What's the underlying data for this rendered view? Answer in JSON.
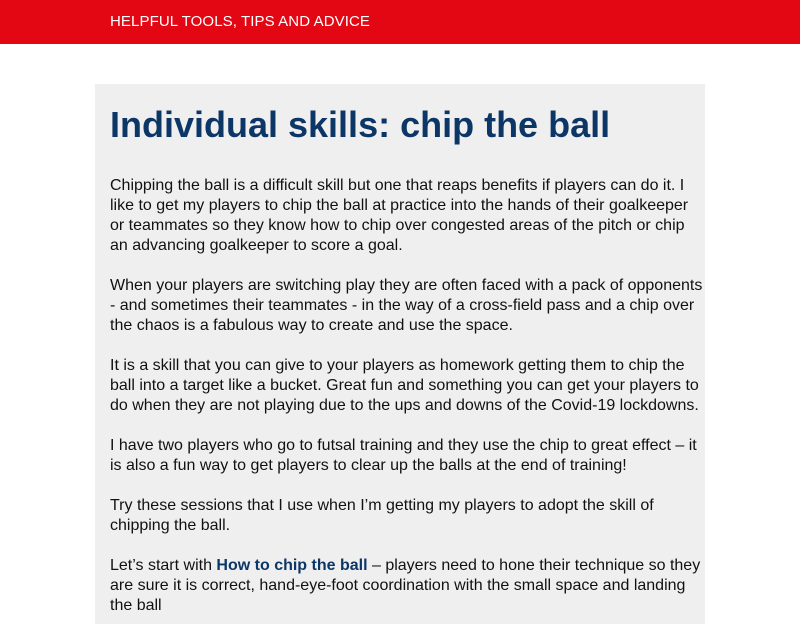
{
  "header": {
    "nav_link": "HELPFUL TOOLS, TIPS AND ADVICE"
  },
  "article": {
    "title": "Individual skills: chip the ball",
    "paragraphs": [
      "Chipping the ball is a difficult skill but one that reaps benefits if players can do it. I like to get my players to chip the ball at practice into the hands of their goalkeeper or teammates so they know how to chip over congested areas of the pitch or chip an advancing goalkeeper to score a goal.",
      "When your players are switching play they are often faced with a pack of opponents - and sometimes their teammates - in the way of a cross-field pass and a chip over the chaos is a fabulous way to create and use the space.",
      "It is a skill that you can give to your players as homework getting them to chip the ball into a target like a bucket. Great fun and something you can get your players to do when they are not playing due to the ups and downs of the Covid-19 lockdowns.",
      "I have two players who go to futsal training and they use the chip to great effect – it is also a fun way to get players to clear up the balls at the end of training!",
      "Try these sessions that I use when I’m getting my players to adopt the skill of chipping the ball."
    ],
    "last_paragraph": {
      "prefix": "Let’s start with ",
      "link_text": "How to chip the ball",
      "suffix": " – players need to hone their technique so they are sure it is correct, hand-eye-foot coordination with the small space and landing the ball"
    }
  },
  "colors": {
    "brand_red": "#e30613",
    "title_blue": "#0b3665",
    "panel_bg": "#f0eff0"
  }
}
